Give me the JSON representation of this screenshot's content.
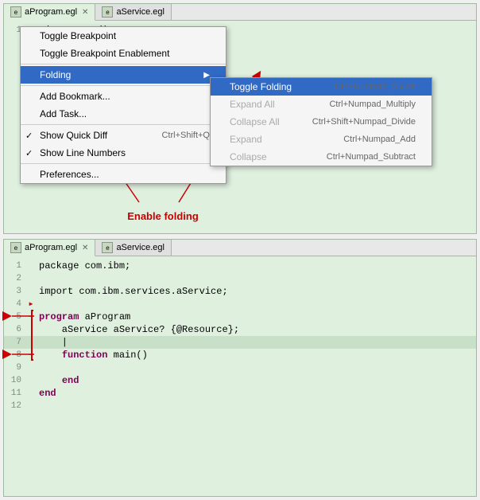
{
  "topPanel": {
    "tabs": [
      {
        "label": "aProgram.egl",
        "active": true,
        "hasClose": true
      },
      {
        "label": "aService.egl",
        "active": false,
        "hasClose": false
      }
    ],
    "codeLine": "package com.ibm;"
  },
  "contextMenu": {
    "items": [
      {
        "label": "Toggle Breakpoint",
        "shortcut": "",
        "checkmark": false,
        "separator": false,
        "disabled": false,
        "submenu": false
      },
      {
        "label": "Toggle Breakpoint Enablement",
        "shortcut": "",
        "checkmark": false,
        "separator": false,
        "disabled": false,
        "submenu": false
      },
      {
        "separator": true
      },
      {
        "label": "Folding",
        "shortcut": "",
        "checkmark": false,
        "separator": false,
        "disabled": false,
        "submenu": true,
        "highlighted": true
      },
      {
        "separator": true
      },
      {
        "label": "Add Bookmark...",
        "shortcut": "",
        "checkmark": false,
        "separator": false,
        "disabled": false,
        "submenu": false
      },
      {
        "label": "Add Task...",
        "shortcut": "",
        "checkmark": false,
        "separator": false,
        "disabled": false,
        "submenu": false
      },
      {
        "separator": true
      },
      {
        "label": "Show Quick Diff",
        "shortcut": "Ctrl+Shift+Q",
        "checkmark": true,
        "separator": false,
        "disabled": false,
        "submenu": false
      },
      {
        "label": "Show Line Numbers",
        "shortcut": "",
        "checkmark": true,
        "separator": false,
        "disabled": false,
        "submenu": false
      },
      {
        "separator": true
      },
      {
        "label": "Preferences...",
        "shortcut": "",
        "checkmark": false,
        "separator": false,
        "disabled": false,
        "submenu": false
      }
    ],
    "submenuItems": [
      {
        "label": "Toggle Folding",
        "shortcut": "Ctrl+Numpad_Divide",
        "disabled": false
      },
      {
        "label": "Expand All",
        "shortcut": "Ctrl+Numpad_Multiply",
        "disabled": true
      },
      {
        "label": "Collapse All",
        "shortcut": "Ctrl+Shift+Numpad_Divide",
        "disabled": true
      },
      {
        "label": "Expand",
        "shortcut": "Ctrl+Numpad_Add",
        "disabled": true
      },
      {
        "label": "Collapse",
        "shortcut": "Ctrl+Numpad_Subtract",
        "disabled": true
      }
    ]
  },
  "enableFoldingLabel": "Enable folding",
  "bottomPanel": {
    "tabs": [
      {
        "label": "aProgram.egl",
        "active": true,
        "hasClose": true
      },
      {
        "label": "aService.egl",
        "active": false,
        "hasClose": false
      }
    ],
    "lines": [
      {
        "num": "1",
        "fold": "",
        "content": "package com.ibm;",
        "cursor": false
      },
      {
        "num": "2",
        "fold": "",
        "content": "",
        "cursor": false
      },
      {
        "num": "3",
        "fold": "",
        "content": "import com.ibm.services.aService;",
        "cursor": false
      },
      {
        "num": "4",
        "fold": "▸",
        "content": "",
        "cursor": false
      },
      {
        "num": "5",
        "fold": "−",
        "content": "program aProgram",
        "cursor": false,
        "hasKW": true,
        "kw": "program"
      },
      {
        "num": "6",
        "fold": "",
        "content": "    aService aService? {@Resource};",
        "cursor": false
      },
      {
        "num": "7",
        "fold": "",
        "content": "    |",
        "cursor": true
      },
      {
        "num": "8",
        "fold": "−",
        "content": "    function main()",
        "cursor": false,
        "hasKW": true,
        "kw": "function"
      },
      {
        "num": "9",
        "fold": "",
        "content": "",
        "cursor": false
      },
      {
        "num": "10",
        "fold": "",
        "content": "    end",
        "cursor": false,
        "hasKW": true,
        "kw": "end"
      },
      {
        "num": "11",
        "fold": "",
        "content": "end",
        "cursor": false,
        "hasKW": true,
        "kw": "end"
      },
      {
        "num": "12",
        "fold": "",
        "content": "",
        "cursor": false
      }
    ]
  }
}
